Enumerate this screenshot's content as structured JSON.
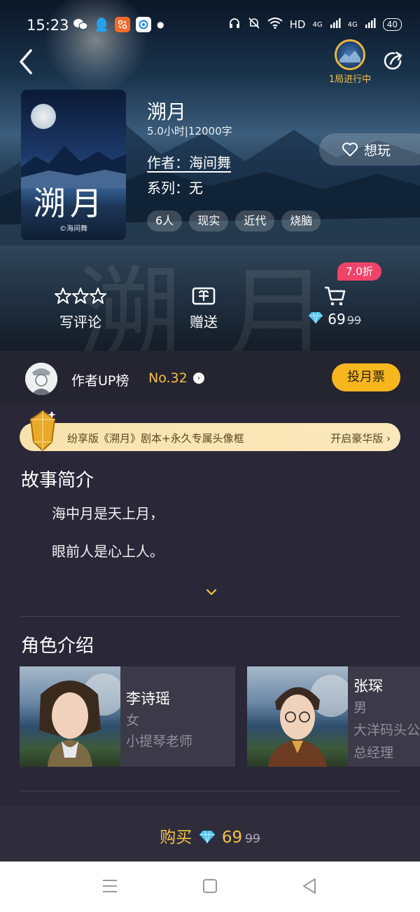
{
  "status_bar": {
    "time": "15:23",
    "network": "HD",
    "signal1": "4G",
    "signal2": "4G",
    "battery": "40"
  },
  "header": {
    "progress_text": "1局进行中"
  },
  "book": {
    "title": "溯月",
    "meta": "5.0小时|12000字",
    "author": "作者：海间舞",
    "series": "系列：无",
    "tags": [
      "6人",
      "现实",
      "近代",
      "烧脑"
    ],
    "cover_title": "溯月",
    "cover_author": "©海间舞",
    "bg_title": "溯月"
  },
  "wish": {
    "label": "想玩"
  },
  "actions": {
    "review_label": "写评论",
    "gift_label": "赠送",
    "discount": "7.0折",
    "price": "69",
    "original_price": "99"
  },
  "author_up": {
    "label": "作者UP榜",
    "rank": "No.32",
    "vote_label": "投月票"
  },
  "promo": {
    "text": "纷享版《溯月》剧本+永久专属头像框",
    "link": "开启豪华版 ›"
  },
  "story": {
    "title": "故事简介",
    "lines": [
      "海中月是天上月，",
      "眼前人是心上人。"
    ]
  },
  "characters": {
    "title": "角色介绍",
    "list": [
      {
        "name": "李诗瑶",
        "gender": "女",
        "role": "小提琴老师"
      },
      {
        "name": "张琛",
        "gender": "男",
        "role": "大洋码头公",
        "role2": "总经理"
      }
    ]
  },
  "buy": {
    "label": "购买",
    "price": "69",
    "original_price": "99"
  },
  "colors": {
    "accent_gold": "#f2c244",
    "vote_button": "#f6b71e",
    "discount_badge": "#f0436a",
    "page_bg": "#2a2838"
  }
}
